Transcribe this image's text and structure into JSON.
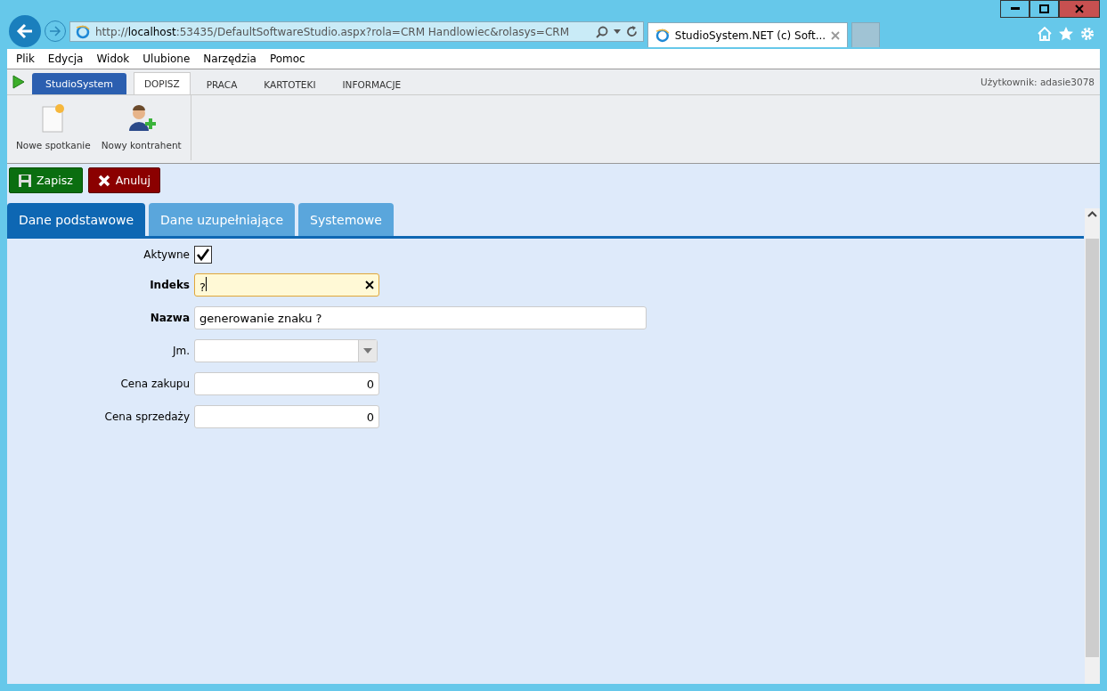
{
  "browser": {
    "address": [
      {
        "text": "http://",
        "host": false
      },
      {
        "text": "localhost",
        "host": true
      },
      {
        "text": ":53435/DefaultSoftwareStudio.aspx?rola=CRM Handlowiec&rolasys=CRM",
        "host": false
      }
    ],
    "tab_title": "StudioSystem.NET (c) Soft...",
    "menu": [
      "Plik",
      "Edycja",
      "Widok",
      "Ulubione",
      "Narzędzia",
      "Pomoc"
    ]
  },
  "app": {
    "brand": "StudioSystem",
    "tabs": [
      {
        "label": "DOPISZ",
        "selected": true
      },
      {
        "label": "PRACA",
        "selected": false
      },
      {
        "label": "KARTOTEKI",
        "selected": false
      },
      {
        "label": "INFORMACJE",
        "selected": false
      }
    ],
    "user": "Użytkownik: adasie3078"
  },
  "ribbon": [
    {
      "kind": "meeting",
      "label": "Nowe spotkanie"
    },
    {
      "kind": "contact",
      "label": "Nowy kontrahent"
    }
  ],
  "actions": [
    {
      "kind": "save",
      "label": "Zapisz"
    },
    {
      "kind": "cancel",
      "label": "Anuluj"
    }
  ],
  "form_tabs": [
    {
      "label": "Dane podstawowe",
      "selected": true
    },
    {
      "label": "Dane uzupełniające",
      "selected": false
    },
    {
      "label": "Systemowe",
      "selected": false
    }
  ],
  "fields": [
    {
      "kind": "checkbox",
      "label": "Aktywne",
      "bold": false,
      "checked": true
    },
    {
      "kind": "text",
      "label": "Indeks",
      "bold": true,
      "value": "?",
      "focused": true
    },
    {
      "kind": "longtext",
      "label": "Nazwa",
      "bold": true,
      "value": "generowanie znaku ?",
      "focused": false
    },
    {
      "kind": "select",
      "label": "Jm.",
      "bold": false
    },
    {
      "kind": "number",
      "label": "Cena zakupu",
      "bold": false,
      "value": "0",
      "focused": false
    },
    {
      "kind": "number",
      "label": "Cena sprzedaży",
      "bold": false,
      "value": "0",
      "focused": false
    }
  ]
}
